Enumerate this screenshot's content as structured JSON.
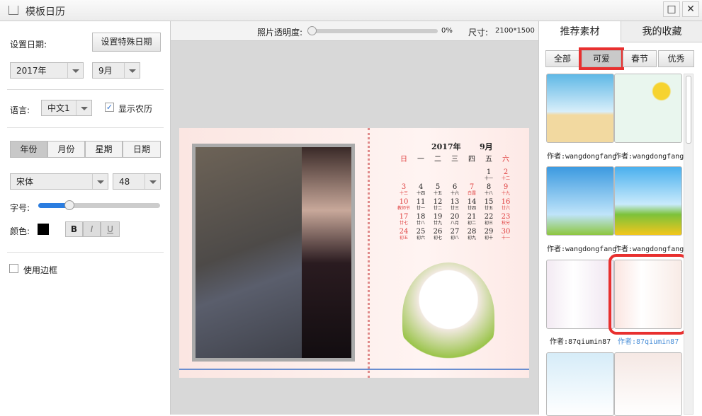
{
  "window": {
    "title": "模板日历",
    "maximize": "□",
    "close": "✕"
  },
  "left": {
    "date_label": "设置日期:",
    "special_date_button": "设置特殊日期",
    "year": "2017年",
    "month": "9月",
    "language_label": "语言:",
    "language": "中文1",
    "show_lunar": "显示农历",
    "show_lunar_checked": true,
    "segments": [
      "年份",
      "月份",
      "星期",
      "日期"
    ],
    "active_segment": 0,
    "font": "宋体",
    "font_size": "48",
    "size_label": "字号:",
    "size_slider": 0.25,
    "color_label": "颜色:",
    "color": "#000000",
    "bold": "B",
    "italic": "I",
    "underline": "U",
    "border_label": "使用边框",
    "border_checked": false
  },
  "toolbar": {
    "opacity_label": "照片透明度:",
    "opacity": "0%",
    "opacity_value": 0,
    "size_label": "尺寸:",
    "size": "2100*1500"
  },
  "calendar": {
    "year": "2017年",
    "month": "9月",
    "weekdays": [
      "日",
      "一",
      "二",
      "三",
      "四",
      "五",
      "六"
    ],
    "rows": [
      [
        [
          "",
          ""
        ],
        [
          "",
          ""
        ],
        [
          "",
          ""
        ],
        [
          "",
          ""
        ],
        [
          "",
          ""
        ],
        [
          "1",
          "十一"
        ],
        [
          "2",
          "十二"
        ]
      ],
      [
        [
          "3",
          "十三"
        ],
        [
          "4",
          "十四"
        ],
        [
          "5",
          "十五"
        ],
        [
          "6",
          "十六"
        ],
        [
          "7",
          "白露"
        ],
        [
          "8",
          "十八"
        ],
        [
          "9",
          "十九"
        ]
      ],
      [
        [
          "10",
          "教师节"
        ],
        [
          "11",
          "廿一"
        ],
        [
          "12",
          "廿二"
        ],
        [
          "13",
          "廿三"
        ],
        [
          "14",
          "廿四"
        ],
        [
          "15",
          "廿五"
        ],
        [
          "16",
          "廿六"
        ]
      ],
      [
        [
          "17",
          "廿七"
        ],
        [
          "18",
          "廿八"
        ],
        [
          "19",
          "廿九"
        ],
        [
          "20",
          "八月"
        ],
        [
          "21",
          "初二"
        ],
        [
          "22",
          "初三"
        ],
        [
          "23",
          "秋分"
        ]
      ],
      [
        [
          "24",
          "初五"
        ],
        [
          "25",
          "初六"
        ],
        [
          "26",
          "初七"
        ],
        [
          "27",
          "初八"
        ],
        [
          "28",
          "初九"
        ],
        [
          "29",
          "初十"
        ],
        [
          "30",
          "十一"
        ]
      ]
    ]
  },
  "right": {
    "tabs": [
      "推荐素材",
      "我的收藏"
    ],
    "filters": [
      "全部",
      "可爱",
      "春节",
      "优秀"
    ],
    "active_filter": 1,
    "authors": [
      "作者:wangdongfang",
      "作者:wangdongfang",
      "作者:wangdongfang",
      "作者:wangdongfang",
      "作者:87qiumin87",
      "作者:87qiumin87"
    ],
    "highlight": "#e8302f"
  }
}
